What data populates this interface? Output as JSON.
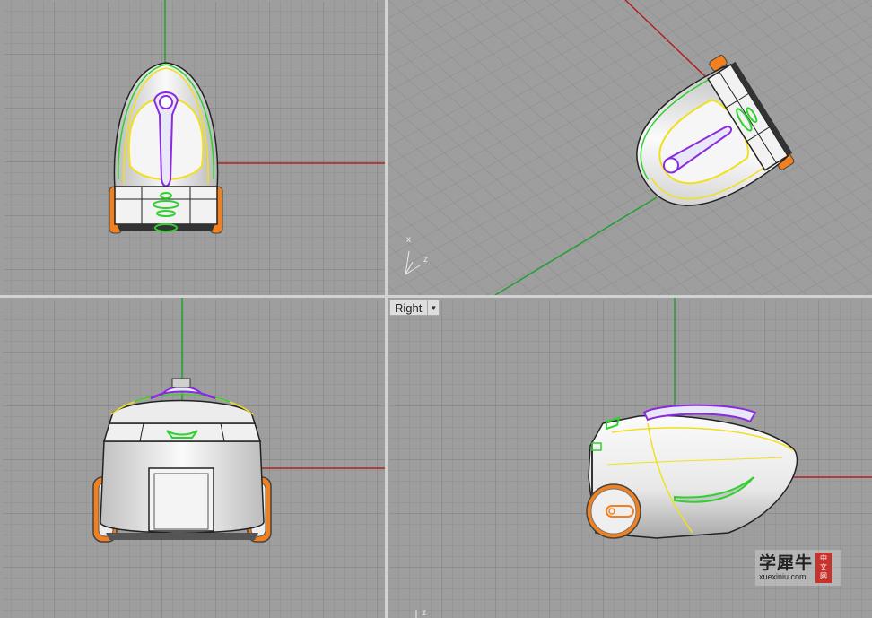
{
  "viewports": {
    "top": {},
    "perspective": {
      "axis_labels": {
        "x": "x",
        "z": "z"
      }
    },
    "front": {},
    "right": {
      "label": "Right",
      "axis_label_z": "z"
    }
  },
  "watermark": {
    "chinese": "学犀牛",
    "url": "xuexiniu.com",
    "seal": [
      "中",
      "文",
      "网"
    ]
  },
  "colors": {
    "grid_bg": "#9e9e9e",
    "grid_line": "#8c8c8c",
    "grid_major": "#7c7c7c",
    "axis_x": "#b02020",
    "axis_y": "#20a030",
    "curve_yellow": "#f0e020",
    "curve_green": "#30d030",
    "curve_purple": "#8a2be2",
    "wheel_orange": "#f08020"
  }
}
